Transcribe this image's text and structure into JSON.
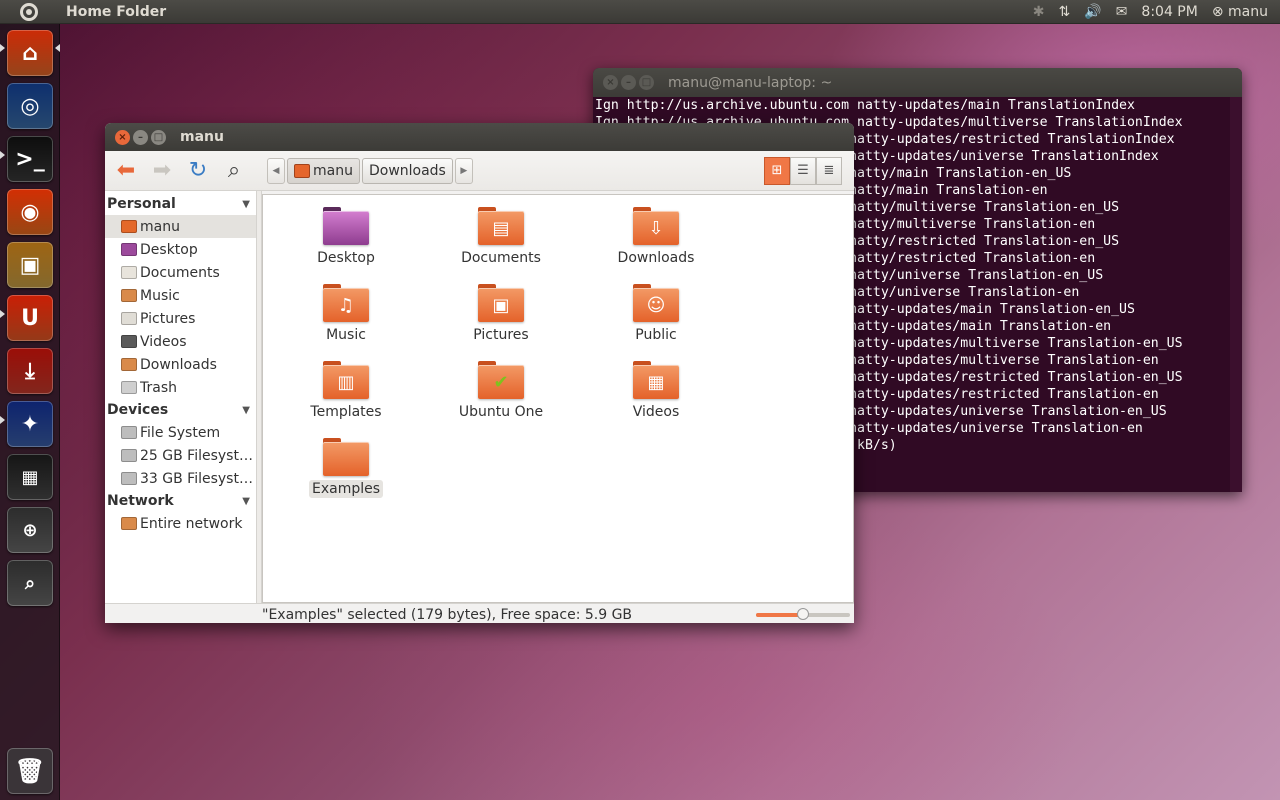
{
  "top_panel": {
    "app_title": "Home Folder",
    "clock": "8:04 PM",
    "user": "manu",
    "bluetooth_glyph": "✱",
    "network_glyph": "⇅",
    "volume_glyph": "🔊",
    "mail_glyph": "✉",
    "session_glyph": "⊗"
  },
  "launcher": {
    "items": [
      {
        "name": "home-folder",
        "glyph": "⌂",
        "color": "#e4692a"
      },
      {
        "name": "chromium",
        "glyph": "◎",
        "color": "#3b6ea8"
      },
      {
        "name": "terminal",
        "glyph": ">_",
        "color": "#3a3a3a"
      },
      {
        "name": "firefox",
        "glyph": "◉",
        "color": "#e86d1f"
      },
      {
        "name": "software-center",
        "glyph": "▣",
        "color": "#c9a046"
      },
      {
        "name": "ubuntu-one",
        "glyph": "U",
        "color": "#e35926"
      },
      {
        "name": "update-manager",
        "glyph": "⤓",
        "color": "#c73b2c"
      },
      {
        "name": "movie-player",
        "glyph": "✦",
        "color": "#3b5fa8"
      },
      {
        "name": "workspaces",
        "glyph": "▦",
        "color": "#4a4a4a"
      },
      {
        "name": "applications-lens",
        "glyph": "⊕",
        "color": "#6a6a6a"
      },
      {
        "name": "files-lens",
        "glyph": "⌕",
        "color": "#6a6a6a"
      }
    ],
    "trash_glyph": "🗑"
  },
  "terminal": {
    "title": "manu@manu-laptop: ~",
    "lines": [
      "Ign http://us.archive.ubuntu.com natty-updates/main TranslationIndex",
      "Ign http://us.archive.ubuntu.com natty-updates/multiverse TranslationIndex",
      "                                natty-updates/restricted TranslationIndex",
      "                                natty-updates/universe TranslationIndex",
      "                                natty/main Translation-en_US",
      "                                natty/main Translation-en",
      "                                natty/multiverse Translation-en_US",
      "                                natty/multiverse Translation-en",
      "                                natty/restricted Translation-en_US",
      "                                natty/restricted Translation-en",
      "                                natty/universe Translation-en_US",
      "                                natty/universe Translation-en",
      "                                natty-updates/main Translation-en_US",
      "                                natty-updates/main Translation-en",
      "                                natty-updates/multiverse Translation-en_US",
      "                                natty-updates/multiverse Translation-en",
      "                                natty-updates/restricted Translation-en_US",
      "                                natty-updates/restricted Translation-en",
      "                                natty-updates/universe Translation-en_US",
      "                                natty-updates/universe Translation-en",
      "                               3 kB/s)"
    ]
  },
  "nautilus": {
    "title": "manu",
    "toolbar": {
      "back_glyph": "⬅",
      "forward_glyph": "➡",
      "reload_glyph": "↻",
      "search_glyph": "⌕"
    },
    "pathbar": {
      "left_arrow": "◀",
      "right_arrow": "▶",
      "crumbs": [
        "manu",
        "Downloads"
      ]
    },
    "view_buttons": [
      "⊞",
      "☰",
      "≣"
    ],
    "sidebar": {
      "sections": [
        {
          "title": "Personal",
          "items": [
            {
              "label": "manu",
              "color": "#e4692a"
            },
            {
              "label": "Desktop",
              "color": "#9c4a9c"
            },
            {
              "label": "Documents",
              "color": "#e8e4dc"
            },
            {
              "label": "Music",
              "color": "#d98a4a"
            },
            {
              "label": "Pictures",
              "color": "#e0ddd6"
            },
            {
              "label": "Videos",
              "color": "#5a5a5a"
            },
            {
              "label": "Downloads",
              "color": "#d98a4a"
            },
            {
              "label": "Trash",
              "color": "#cfcfcf"
            }
          ]
        },
        {
          "title": "Devices",
          "items": [
            {
              "label": "File System",
              "color": "#bdbdbd"
            },
            {
              "label": "25 GB Filesyst…",
              "color": "#bdbdbd"
            },
            {
              "label": "33 GB Filesyst…",
              "color": "#bdbdbd"
            }
          ]
        },
        {
          "title": "Network",
          "items": [
            {
              "label": "Entire network",
              "color": "#d98a4a"
            }
          ]
        }
      ],
      "collapse_glyph": "▼"
    },
    "files": [
      {
        "label": "Desktop",
        "emblem": ""
      },
      {
        "label": "Documents",
        "emblem": "▤"
      },
      {
        "label": "Downloads",
        "emblem": "⇩"
      },
      {
        "label": "Music",
        "emblem": "♫"
      },
      {
        "label": "Pictures",
        "emblem": "▣"
      },
      {
        "label": "Public",
        "emblem": "☺"
      },
      {
        "label": "Templates",
        "emblem": "▥"
      },
      {
        "label": "Ubuntu One",
        "emblem": "✔"
      },
      {
        "label": "Videos",
        "emblem": "▦"
      },
      {
        "label": "Examples",
        "emblem": ""
      }
    ],
    "status": "\"Examples\" selected (179 bytes), Free space: 5.9 GB",
    "zoom_level": 0.5
  },
  "colors": {
    "accent": "#f07746",
    "terminal_bg": "#300a24"
  }
}
